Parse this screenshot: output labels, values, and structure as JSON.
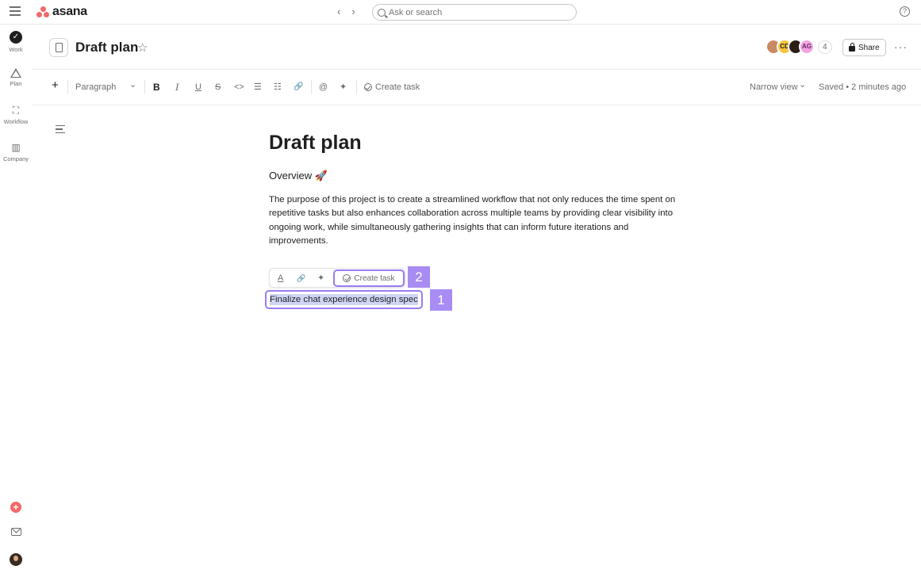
{
  "app": {
    "name": "asana",
    "brand_color": "#f06a6a",
    "accent_color": "#9b7cf2"
  },
  "topbar": {
    "back_label": "‹",
    "forward_label": "›",
    "search_placeholder": "Ask or search",
    "help_label": "?"
  },
  "rail": {
    "items": [
      {
        "label": "Work",
        "icon": "check-circle-icon"
      },
      {
        "label": "Plan",
        "icon": "triangle-icon"
      },
      {
        "label": "Workflow",
        "icon": "workflow-icon"
      },
      {
        "label": "Company",
        "icon": "building-icon"
      }
    ],
    "add_label": "+"
  },
  "header": {
    "title": "Draft plan",
    "star_label": "☆",
    "avatars": [
      {
        "initials": "",
        "color": "#c98b63"
      },
      {
        "initials": "CD",
        "color": "#f8c53d"
      },
      {
        "initials": "",
        "color": "#2c1e16"
      },
      {
        "initials": "AG",
        "color": "#f3a3e4"
      }
    ],
    "member_count": "4",
    "share_label": "Share",
    "more_label": "···"
  },
  "toolbar": {
    "add_label": "+",
    "block_style": "Paragraph",
    "block_style_chevron": "⌄",
    "bold": "B",
    "italic": "I",
    "underline": "U",
    "strike": "S",
    "code": "<>",
    "bullet_list": "☰",
    "numbered_list": "☷",
    "link": "🔗",
    "mention": "@",
    "ai": "✦",
    "create_task": "Create task",
    "view_mode": "Narrow view",
    "view_mode_chevron": "⌄",
    "save_status": "Saved • 2 minutes ago"
  },
  "document": {
    "title": "Draft plan",
    "heading": "Overview 🚀",
    "paragraph": "The purpose of this project is to create a streamlined workflow that not only reduces the time spent on repetitive tasks but also enhances collaboration across multiple teams by providing clear visibility into ongoing work, while simultaneously gathering insights that can inform future iterations and improvements.",
    "selected_line": "Finalize chat experience design spec"
  },
  "floating_toolbar": {
    "text_color": "A",
    "link": "🔗",
    "ai": "✦",
    "create_task": "Create task"
  },
  "annotations": {
    "badge_1": "1",
    "badge_2": "2"
  }
}
